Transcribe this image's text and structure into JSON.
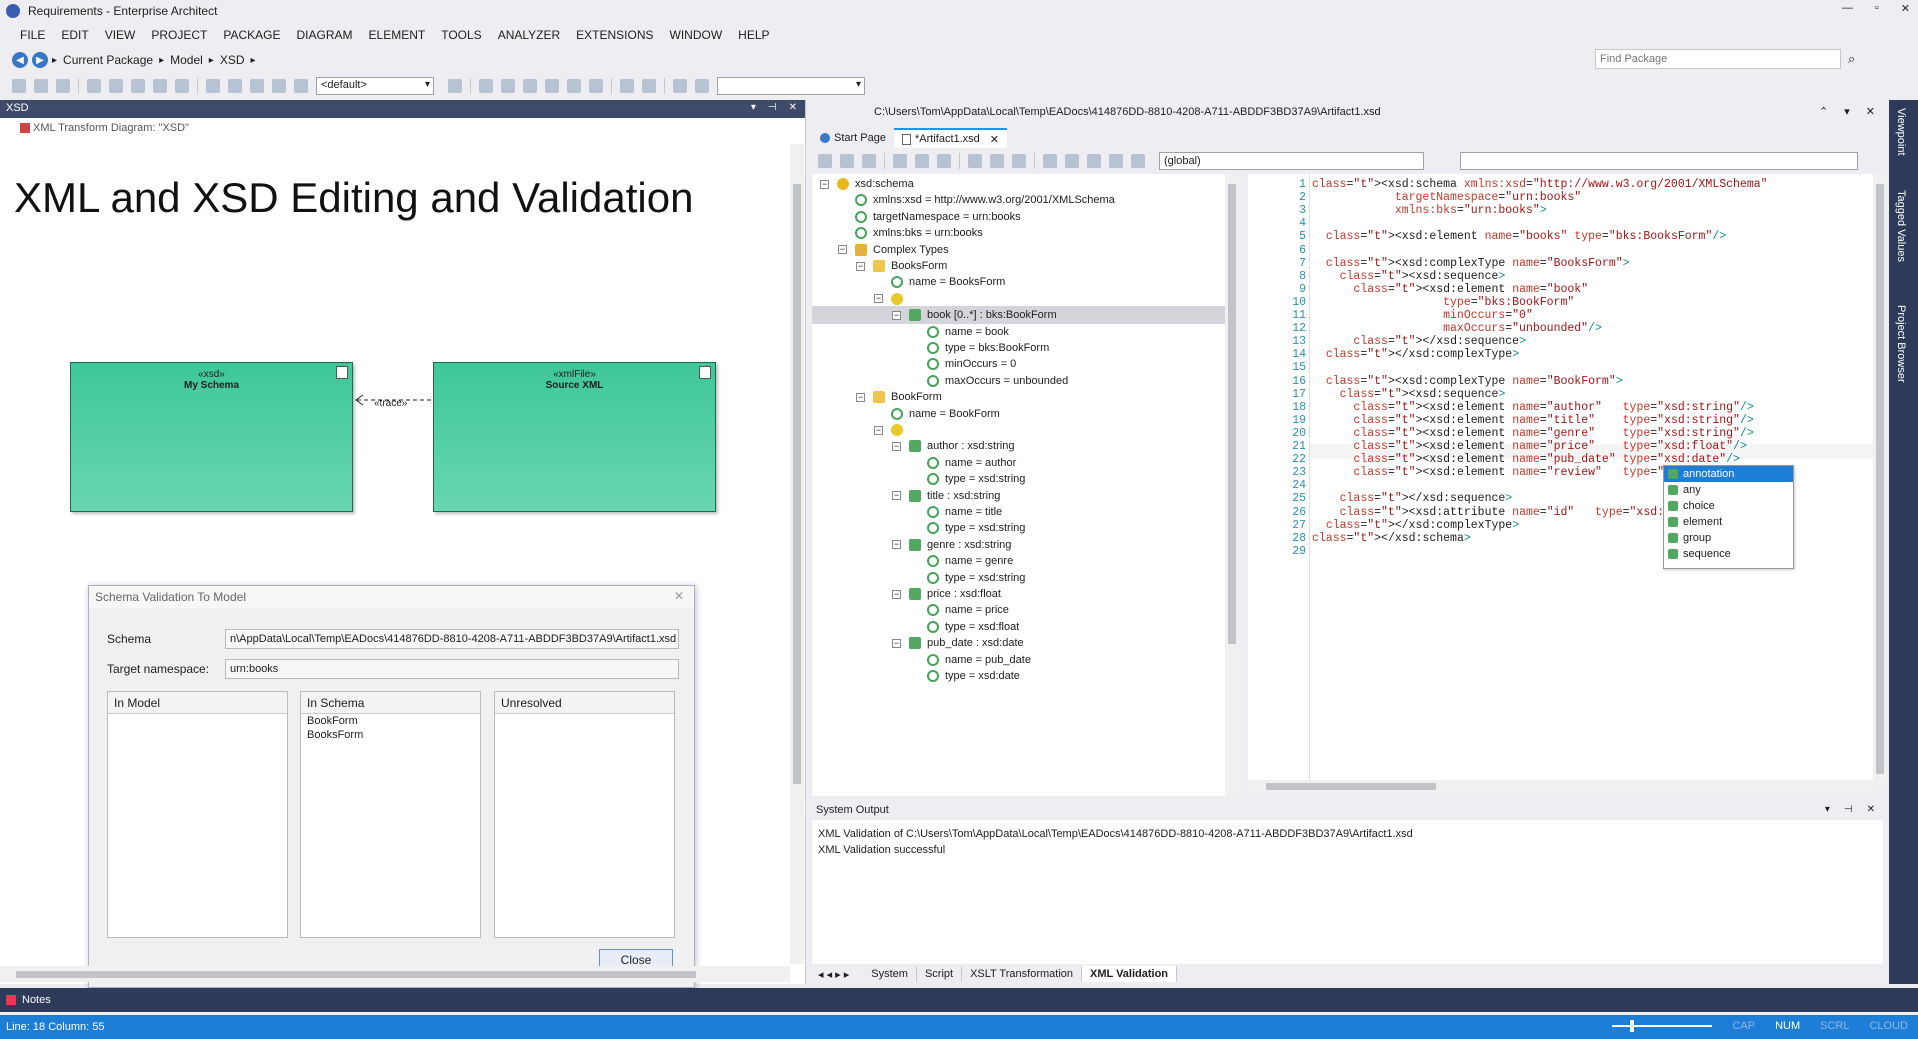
{
  "app": {
    "title": "Requirements - Enterprise Architect"
  },
  "menu": [
    "FILE",
    "EDIT",
    "VIEW",
    "PROJECT",
    "PACKAGE",
    "DIAGRAM",
    "ELEMENT",
    "TOOLS",
    "ANALYZER",
    "EXTENSIONS",
    "WINDOW",
    "HELP"
  ],
  "nav": {
    "breadcrumbs": [
      "Current Package",
      "Model",
      "XSD"
    ],
    "find_placeholder": "Find Package"
  },
  "toolbar": {
    "style_combo": "<default>",
    "second_combo": ""
  },
  "left_panel": {
    "title": "XSD",
    "diagram_label": "XML Transform Diagram: \"XSD\"",
    "heading": "XML and XSD Editing and Validation",
    "elements": [
      {
        "stereotype": "«xsd»",
        "name": "My Schema"
      },
      {
        "stereotype": "«xmlFile»",
        "name": "Source XML"
      }
    ],
    "connector_label": "«trace»"
  },
  "dialog": {
    "title": "Schema Validation To Model",
    "schema_label": "Schema",
    "schema_value": "n\\AppData\\Local\\Temp\\EADocs\\414876DD-8810-4208-A711-ABDDF3BD37A9\\Artifact1.xsd",
    "ns_label": "Target  namespace:",
    "ns_value": "urn:books",
    "lists": [
      {
        "header": "In Model",
        "items": []
      },
      {
        "header": "In Schema",
        "items": [
          "BookForm",
          "BooksForm"
        ]
      },
      {
        "header": "Unresolved",
        "items": []
      }
    ],
    "close_label": "Close"
  },
  "doc": {
    "path": "C:\\Users\\Tom\\AppData\\Local\\Temp\\EADocs\\414876DD-8810-4208-A711-ABDDF3BD37A9\\Artifact1.xsd",
    "tabs": [
      "Start Page",
      "*Artifact1.xsd"
    ],
    "scope": "(global)"
  },
  "tree": [
    {
      "label": "xsd:schema",
      "level": 0,
      "icon": "root",
      "exp": "−"
    },
    {
      "label": "xmlns:xsd = http://www.w3.org/2001/XMLSchema",
      "level": 1,
      "icon": "attr"
    },
    {
      "label": "targetNamespace = urn:books",
      "level": 1,
      "icon": "attr"
    },
    {
      "label": "xmlns:bks = urn:books",
      "level": 1,
      "icon": "attr"
    },
    {
      "label": "Complex Types",
      "level": 1,
      "icon": "ct",
      "exp": "−"
    },
    {
      "label": "BooksForm",
      "level": 2,
      "icon": "type",
      "exp": "−"
    },
    {
      "label": "name = BooksForm",
      "level": 3,
      "icon": "attr"
    },
    {
      "label": "",
      "level": 3,
      "icon": "seq",
      "exp": "−"
    },
    {
      "label": "book [0..*] : bks:BookForm",
      "level": 4,
      "icon": "el",
      "exp": "−",
      "selected": true
    },
    {
      "label": "name = book",
      "level": 5,
      "icon": "attr"
    },
    {
      "label": "type = bks:BookForm",
      "level": 5,
      "icon": "attr"
    },
    {
      "label": "minOccurs = 0",
      "level": 5,
      "icon": "attr"
    },
    {
      "label": "maxOccurs = unbounded",
      "level": 5,
      "icon": "attr"
    },
    {
      "label": "BookForm",
      "level": 2,
      "icon": "type",
      "exp": "−"
    },
    {
      "label": "name = BookForm",
      "level": 3,
      "icon": "attr"
    },
    {
      "label": "",
      "level": 3,
      "icon": "seq",
      "exp": "−"
    },
    {
      "label": "author : xsd:string",
      "level": 4,
      "icon": "el",
      "exp": "−"
    },
    {
      "label": "name = author",
      "level": 5,
      "icon": "attr"
    },
    {
      "label": "type = xsd:string",
      "level": 5,
      "icon": "attr"
    },
    {
      "label": "title : xsd:string",
      "level": 4,
      "icon": "el",
      "exp": "−"
    },
    {
      "label": "name = title",
      "level": 5,
      "icon": "attr"
    },
    {
      "label": "type = xsd:string",
      "level": 5,
      "icon": "attr"
    },
    {
      "label": "genre : xsd:string",
      "level": 4,
      "icon": "el",
      "exp": "−"
    },
    {
      "label": "name = genre",
      "level": 5,
      "icon": "attr"
    },
    {
      "label": "type = xsd:string",
      "level": 5,
      "icon": "attr"
    },
    {
      "label": "price : xsd:float",
      "level": 4,
      "icon": "el",
      "exp": "−"
    },
    {
      "label": "name = price",
      "level": 5,
      "icon": "attr"
    },
    {
      "label": "type = xsd:float",
      "level": 5,
      "icon": "attr"
    },
    {
      "label": "pub_date : xsd:date",
      "level": 4,
      "icon": "el",
      "exp": "−"
    },
    {
      "label": "name = pub_date",
      "level": 5,
      "icon": "attr"
    },
    {
      "label": "type = xsd:date",
      "level": 5,
      "icon": "attr"
    }
  ],
  "code": [
    "<xsd:schema xmlns:xsd=\"http://www.w3.org/2001/XMLSchema\"",
    "            targetNamespace=\"urn:books\"",
    "            xmlns:bks=\"urn:books\">",
    "",
    "  <xsd:element name=\"books\" type=\"bks:BooksForm\"/>",
    "",
    "  <xsd:complexType name=\"BooksForm\">",
    "    <xsd:sequence>",
    "      <xsd:element name=\"book\"",
    "                   type=\"bks:BookForm\"",
    "                   minOccurs=\"0\"",
    "                   maxOccurs=\"unbounded\"/>",
    "      </xsd:sequence>",
    "  </xsd:complexType>",
    "",
    "  <xsd:complexType name=\"BookForm\">",
    "    <xsd:sequence>",
    "      <xsd:element name=\"author\"   type=\"xsd:string\"/>",
    "      <xsd:element name=\"title\"    type=\"xsd:string\"/>",
    "      <xsd:element name=\"genre\"    type=\"xsd:string\"/>",
    "      <xsd:element name=\"price\"    type=\"xsd:float\"/>",
    "      <xsd:element name=\"pub_date\" type=\"xsd:date\"/>",
    "      <xsd:element name=\"review\"   type=\"xsd:string\"/>",
    "",
    "    </xsd:sequence>",
    "    <xsd:attribute name=\"id\"   type=\"xsd:string\"/>",
    "  </xsd:complexType>",
    "</xsd:schema>",
    ""
  ],
  "autocomplete": [
    "annotation",
    "any",
    "choice",
    "element",
    "group",
    "sequence"
  ],
  "system_output": {
    "title": "System Output",
    "lines": [
      "XML Validation of C:\\Users\\Tom\\AppData\\Local\\Temp\\EADocs\\414876DD-8810-4208-A711-ABDDF3BD37A9\\Artifact1.xsd",
      "XML Validation successful"
    ],
    "tabs": [
      "System",
      "Script",
      "XSLT Transformation",
      "XML Validation"
    ],
    "active_tab": "XML Validation"
  },
  "sidebar": [
    "Viewpoint",
    "Tagged Values",
    "Project Browser"
  ],
  "notes": {
    "label": "Notes"
  },
  "status": {
    "position": "Line: 18 Column: 55",
    "indicators": [
      "CAP",
      "NUM",
      "SCRL",
      "CLOUD"
    ]
  },
  "colors": {
    "accent": "#1c7ed6",
    "element_fill": "#3ec79a",
    "panel_dark": "#2d3a5a"
  }
}
